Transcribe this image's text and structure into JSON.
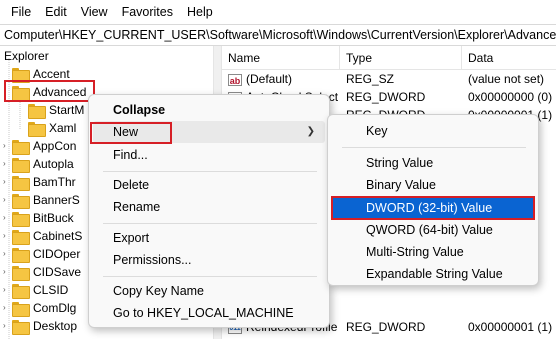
{
  "menubar": {
    "items": [
      "File",
      "Edit",
      "View",
      "Favorites",
      "Help"
    ]
  },
  "address": "Computer\\HKEY_CURRENT_USER\\Software\\Microsoft\\Windows\\CurrentVersion\\Explorer\\Advanced",
  "tree": {
    "items": [
      "Explorer",
      "Accent",
      "Advanced",
      "StartM",
      "Xaml",
      "AppCon",
      "Autopla",
      "BamThr",
      "BannerS",
      "BitBuck",
      "CabinetS",
      "CIDOper",
      "CIDSave",
      "CLSID",
      "ComDlg",
      "Desktop"
    ]
  },
  "list": {
    "headers": {
      "name": "Name",
      "type": "Type",
      "data": "Data"
    },
    "rows": [
      {
        "name": "(Default)",
        "type": "REG_SZ",
        "data": "(value not set)"
      },
      {
        "name": "AutoCheckSelect",
        "type": "REG_DWORD",
        "data": "0x00000000 (0)"
      },
      {
        "name": "",
        "type": "REG_DWORD",
        "data": "0x00000001 (1)"
      },
      {
        "name": "ReindexedProfile",
        "type": "REG_DWORD",
        "data": "0x00000001 (1)"
      }
    ]
  },
  "context_menu": {
    "items": {
      "collapse": "Collapse",
      "new": "New",
      "find": "Find...",
      "delete": "Delete",
      "rename": "Rename",
      "export": "Export",
      "permissions": "Permissions...",
      "copy_key_name": "Copy Key Name",
      "goto": "Go to HKEY_LOCAL_MACHINE"
    }
  },
  "submenu": {
    "items": {
      "key": "Key",
      "string": "String Value",
      "binary": "Binary Value",
      "dword": "DWORD (32-bit) Value",
      "qword": "QWORD (64-bit) Value",
      "multi_string": "Multi-String Value",
      "expandable": "Expandable String Value"
    }
  },
  "colors": {
    "highlight": "#d61f26",
    "selection": "#0a64d2",
    "folder": "#f5c542"
  },
  "icons": {
    "string_value": "ab-icon",
    "dword_value": "binary-icon",
    "folder": "folder-icon"
  }
}
